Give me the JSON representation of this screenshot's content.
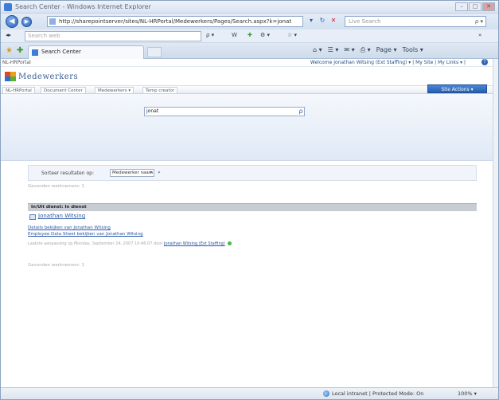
{
  "window": {
    "title": "Search Center - Windows Internet Explorer",
    "minimize": "–",
    "maximize": "□",
    "close": "✕"
  },
  "address_bar": {
    "url": "http://sharepointserver/sites/NL-HRPortal/Medewerkers/Pages/Search.aspx?k=jonat",
    "back": "◀",
    "forward": "▶"
  },
  "live_search": {
    "placeholder": "Live Search"
  },
  "web_search": {
    "placeholder": "Search web"
  },
  "favorites": {
    "star": "★",
    "add": "✚"
  },
  "tab": {
    "label": "Search Center"
  },
  "command_bar": {
    "items": [
      "⌂ ▾",
      "☰ ▾",
      "✉ ▾",
      "⎙ ▾",
      "Page ▾",
      "Tools ▾"
    ]
  },
  "sharepoint": {
    "breadcrumb": "NL-HRPortal",
    "welcome": "Welcome Jonathan Witsing (Ext Staffing) ▾ | My Site | My Links ▾ |",
    "help": "?",
    "site_title": "Medewerkers",
    "nav": [
      "NL-HRPortal",
      "Document Center",
      "Medewerkers ▾",
      "Temp creator"
    ],
    "site_actions": "Site Actions ▾",
    "search_query": "jonat",
    "search_go_icon": "ρ",
    "sort_label": "Sorteer resultaten op:",
    "sort_value": "Medewerker naam",
    "sort_caret": "▾",
    "sort_go": "»",
    "result_count_top": "Gevonden werknemers: 1",
    "group_header": "In/Uit dienst: In dienst",
    "result_name": "Jonathan Witsing",
    "result_link_1": "Details bekijken van Jonathan Witsing",
    "result_link_2": "Employee Data Sheet bekijken van Jonathan Witsing",
    "result_meta": "Laatste aanpassing op Monday, September 24, 2007 10:46:07 door",
    "result_meta_author": "Jonathan Witsing (Ext Staffing)",
    "result_count_bottom": "Gevonden werknemers: 1"
  },
  "status_bar": {
    "zone": "Local intranet | Protected Mode: On",
    "zoom": "100% ▾"
  },
  "colors": {
    "accent": "#2a56a4",
    "site_actions": "#245fb0",
    "presence": "#3fbf3f"
  }
}
